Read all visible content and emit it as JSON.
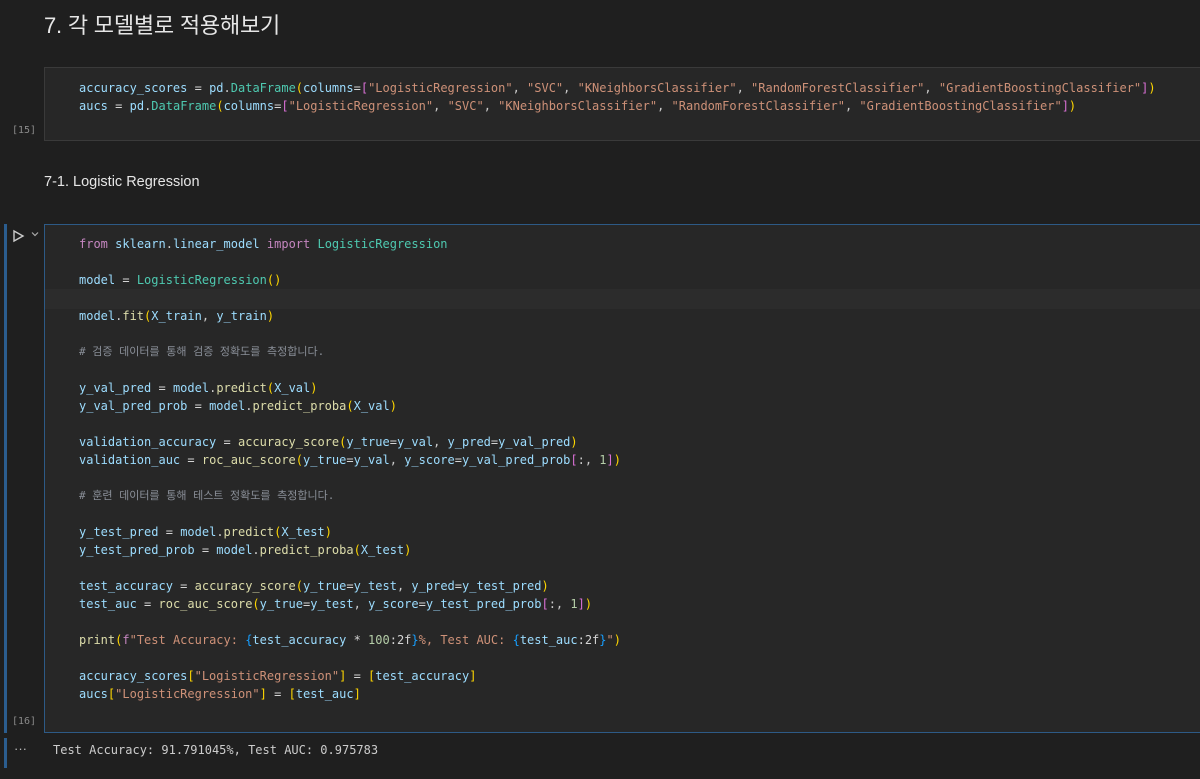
{
  "markdown": {
    "heading1": "7. 각 모델별로 적용해보기",
    "heading2": "7-1. Logistic Regression"
  },
  "cells": {
    "cell15": {
      "exec_count": "[15]"
    },
    "cell16": {
      "exec_count": "[16]"
    }
  },
  "output": {
    "ellipsis": "···",
    "text": "Test Accuracy: 91.791045%, Test AUC: 0.975783"
  },
  "icons": {
    "run": "play-icon",
    "collapse": "chevron-down-icon"
  }
}
